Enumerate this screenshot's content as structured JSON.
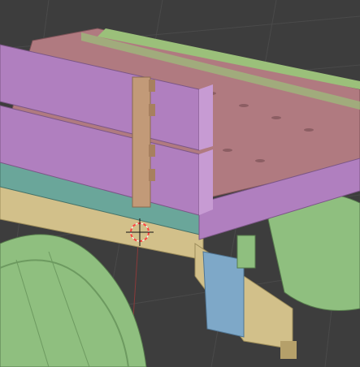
{
  "viewport": {
    "mode": "3d-viewport",
    "background_color": "#3d3d3d",
    "grid_color": "#474747",
    "grid_axis_color": "#8a3a3a"
  },
  "scene_objects": [
    {
      "name": "wheel-left",
      "color": "#8fbf7f"
    },
    {
      "name": "wheel-right",
      "color": "#8fbf7f"
    },
    {
      "name": "cart-floor-planks",
      "color": "#b07a80"
    },
    {
      "name": "side-rail-green",
      "color": "#9bc07a"
    },
    {
      "name": "side-panel-purple",
      "color": "#b07fbf"
    },
    {
      "name": "front-beam-teal",
      "color": "#6aa69a"
    },
    {
      "name": "bottom-beam-tan",
      "color": "#d2c08a"
    },
    {
      "name": "axle-support-blue",
      "color": "#7ea8c8"
    },
    {
      "name": "hinge-strap",
      "color": "#c29a78"
    }
  ],
  "cursor": {
    "name": "3d-cursor",
    "colors": [
      "#ff4040",
      "#ffffff"
    ]
  }
}
